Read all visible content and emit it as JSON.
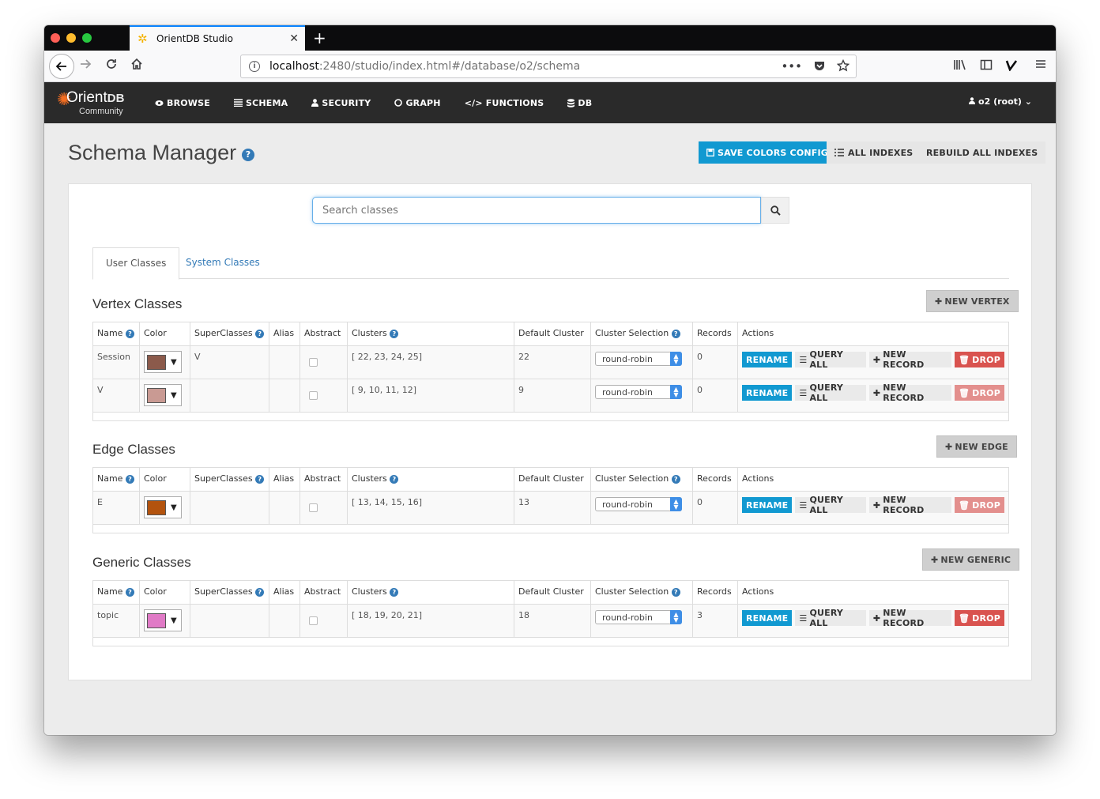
{
  "browser": {
    "tab_title": "OrientDB Studio",
    "url_host": "localhost",
    "url_path": ":2480/studio/index.html#/database/o2/schema"
  },
  "app": {
    "brand_main": "Orient",
    "brand_db": "DB",
    "brand_sub": "Community",
    "menu": {
      "browse": "BROWSE",
      "schema": "SCHEMA",
      "security": "SECURITY",
      "graph": "GRAPH",
      "functions": "FUNCTIONS",
      "db": "DB"
    },
    "user": "o2 (root)"
  },
  "page": {
    "title": "Schema Manager",
    "save_colors": "SAVE COLORS CONFIG",
    "all_indexes": "ALL INDEXES",
    "rebuild_indexes": "REBUILD ALL INDEXES",
    "search_placeholder": "Search classes",
    "tab_user": "User Classes",
    "tab_system": "System Classes"
  },
  "columns": {
    "name": "Name",
    "color": "Color",
    "superclasses": "SuperClasses",
    "alias": "Alias",
    "abstract": "Abstract",
    "clusters": "Clusters",
    "default_cluster": "Default Cluster",
    "cluster_selection": "Cluster Selection",
    "records": "Records",
    "actions": "Actions"
  },
  "action_labels": {
    "rename": "RENAME",
    "query_all": "QUERY ALL",
    "new_record": "NEW RECORD",
    "drop": "DROP"
  },
  "vertex": {
    "title": "Vertex Classes",
    "new_button": "NEW VERTEX",
    "rows": [
      {
        "name": "Session",
        "color": "#8b5a4b",
        "superclasses": "V",
        "alias": "",
        "clusters": "[ 22, 23, 24, 25]",
        "default_cluster": "22",
        "selection": "round-robin",
        "records": "0"
      },
      {
        "name": "V",
        "color": "#c99a93",
        "superclasses": "",
        "alias": "",
        "clusters": "[ 9, 10, 11, 12]",
        "default_cluster": "9",
        "selection": "round-robin",
        "records": "0"
      }
    ]
  },
  "edge": {
    "title": "Edge Classes",
    "new_button": "NEW EDGE",
    "rows": [
      {
        "name": "E",
        "color": "#b3530e",
        "superclasses": "",
        "alias": "",
        "clusters": "[ 13, 14, 15, 16]",
        "default_cluster": "13",
        "selection": "round-robin",
        "records": "0"
      }
    ]
  },
  "generic": {
    "title": "Generic Classes",
    "new_button": "NEW GENERIC",
    "rows": [
      {
        "name": "topic",
        "color": "#e07ac6",
        "superclasses": "",
        "alias": "",
        "clusters": "[ 18, 19, 20, 21]",
        "default_cluster": "18",
        "selection": "round-robin",
        "records": "3"
      }
    ]
  }
}
